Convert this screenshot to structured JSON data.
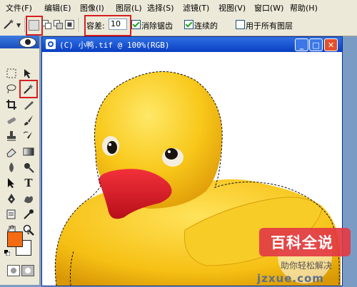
{
  "menu": {
    "items": [
      "文件(F)",
      "编辑(E)",
      "图像(I)",
      "图层(L)",
      "选择(S)",
      "滤镜(T)",
      "视图(V)",
      "窗口(W)",
      "帮助(H)"
    ]
  },
  "options": {
    "tolerance_label": "容差:",
    "tolerance_value": "10",
    "anti_alias_label": "消除锯齿",
    "contiguous_label": "连续的",
    "all_layers_label": "用于所有图层",
    "anti_alias_checked": true,
    "contiguous_checked": true,
    "all_layers_checked": false
  },
  "toolbox": {
    "foreground_color": "#f36b12",
    "background_color": "#ffffff"
  },
  "document": {
    "title": "(C) 小鸭.tif @ 100%(RGB)"
  },
  "watermark": {
    "brand": "百科全说",
    "tagline": "助你轻松解决",
    "site": "jzxue.com"
  },
  "highlight_color": "#d61f1f"
}
